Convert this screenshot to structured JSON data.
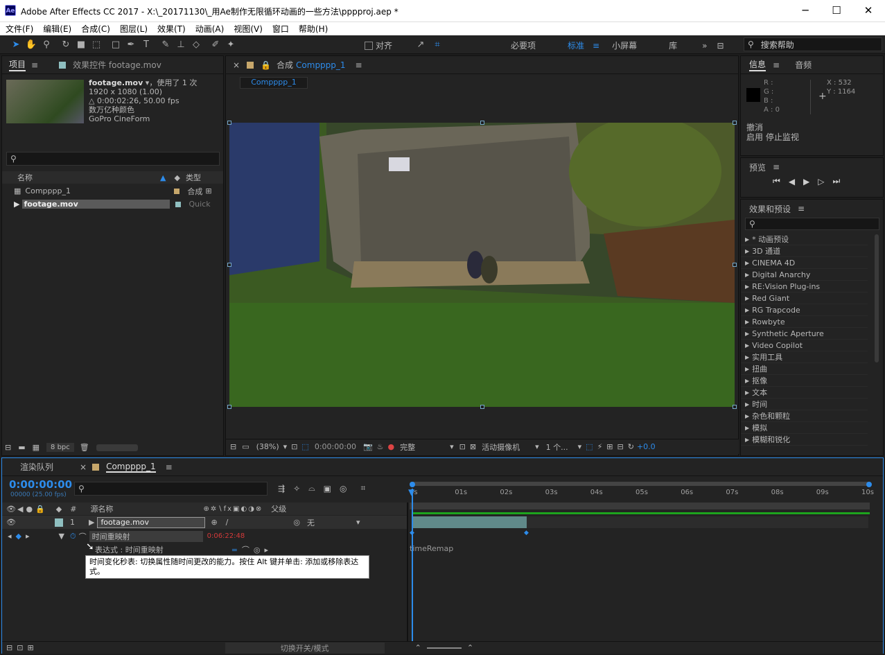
{
  "window": {
    "app_icon": "Ae",
    "title": "Adobe After Effects CC 2017 - X:\\_20171130\\_用Ae制作无限循环动画的一些方法\\pppproj.aep *",
    "minimize": "─",
    "maximize": "☐",
    "close": "✕"
  },
  "menu": [
    "文件(F)",
    "编辑(E)",
    "合成(C)",
    "图层(L)",
    "效果(T)",
    "动画(A)",
    "视图(V)",
    "窗口",
    "帮助(H)"
  ],
  "toolbar": {
    "align_label": "对齐",
    "workspaces": [
      "必要项",
      "标准",
      "小屏幕",
      "库"
    ],
    "active_workspace": "标准",
    "search_placeholder": "搜索帮助"
  },
  "project_panel": {
    "tab_project": "项目",
    "tab_effects": "效果控件 footage.mov",
    "footage_name": "footage.mov",
    "used": "，使用了 1 次",
    "resolution": "1920 x 1080 (1.00)",
    "duration": "△ 0:00:02:26, 50.00 fps",
    "colors": "数万亿种颜色",
    "codec": "GoPro CineForm",
    "col_name": "名称",
    "col_type": "类型",
    "items": [
      {
        "name": "Compppp_1",
        "type": "合成"
      },
      {
        "name": "footage.mov",
        "type": "Quick"
      }
    ],
    "bpc": "8 bpc"
  },
  "comp_panel": {
    "tab_label": "合成",
    "comp_name": "Compppp_1",
    "breadcrumb": "Compppp_1",
    "zoom": "(38%)",
    "timecode": "0:00:00:00",
    "resolution": "完整",
    "camera": "活动摄像机",
    "views": "1 个...",
    "exposure": "+0.0"
  },
  "info_panel": {
    "tab_info": "信息",
    "tab_audio": "音频",
    "r": "R :",
    "g": "G :",
    "b": "B :",
    "a": "A : 0",
    "x": "X : 532",
    "y": "Y : 1164",
    "undo_label": "撤消",
    "undo_action": "启用 停止监视"
  },
  "preview_panel": {
    "title": "预览"
  },
  "effects_panel": {
    "title": "效果和预设",
    "items": [
      "* 动画预设",
      "3D 通道",
      "CINEMA 4D",
      "Digital Anarchy",
      "RE:Vision Plug-ins",
      "Red Giant",
      "RG Trapcode",
      "Rowbyte",
      "Synthetic Aperture",
      "Video Copilot",
      "实用工具",
      "扭曲",
      "抠像",
      "文本",
      "时间",
      "杂色和颗粒",
      "模拟",
      "模糊和锐化"
    ]
  },
  "timeline": {
    "tab_render": "渲染队列",
    "tab_comp": "Compppp_1",
    "timecode": "0:00:00:00",
    "frames": "00000 (25.00 fps)",
    "col_source": "源名称",
    "col_parent": "父级",
    "layer_index": "1",
    "layer_name": "footage.mov",
    "parent_value": "无",
    "prop_name": "时间重映射",
    "prop_value": "0:06:22:48",
    "expr_label": "表达式 : 时间重映射",
    "expr_text": "timeRemap",
    "tooltip": "时间变化秒表: 切换属性随时间更改的能力。按住 Alt 键并单击: 添加或移除表达式。",
    "ruler": [
      "0s",
      "01s",
      "02s",
      "03s",
      "04s",
      "05s",
      "06s",
      "07s",
      "08s",
      "09s",
      "10s"
    ],
    "toggle_label": "切换开关/模式"
  }
}
